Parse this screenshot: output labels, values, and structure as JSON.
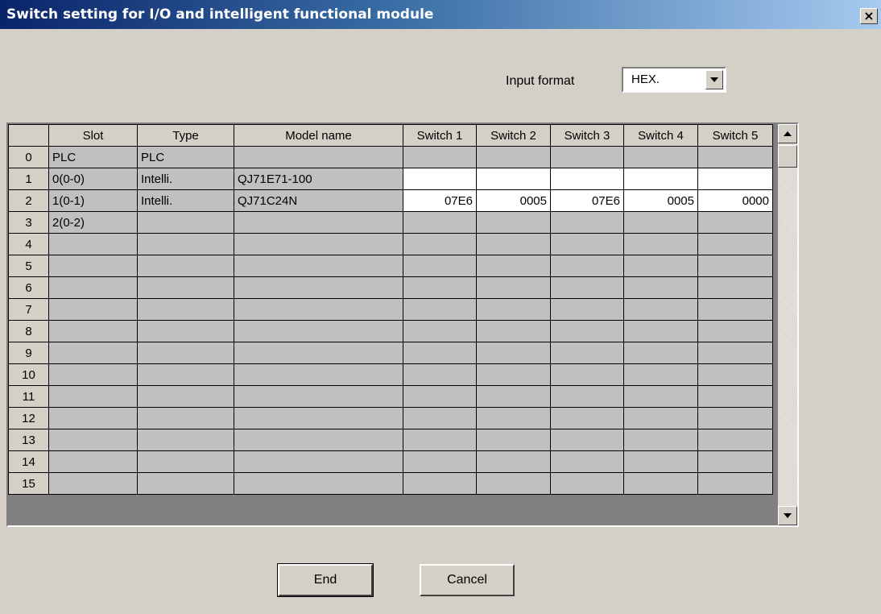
{
  "window": {
    "title": "Switch setting for I/O and intelligent functional module",
    "close_label": "×"
  },
  "input_format": {
    "label": "Input format",
    "value": "HEX."
  },
  "table": {
    "headers": [
      "",
      "Slot",
      "Type",
      "Model name",
      "Switch 1",
      "Switch 2",
      "Switch 3",
      "Switch 4",
      "Switch 5"
    ],
    "rows": [
      [
        "0",
        "PLC",
        "PLC",
        "",
        "",
        "",
        "",
        "",
        ""
      ],
      [
        "1",
        "0(0-0)",
        "Intelli.",
        "QJ71E71-100",
        "",
        "",
        "",
        "",
        ""
      ],
      [
        "2",
        "1(0-1)",
        "Intelli.",
        "QJ71C24N",
        "07E6",
        "0005",
        "07E6",
        "0005",
        "0000"
      ],
      [
        "3",
        "2(0-2)",
        "",
        "",
        "",
        "",
        "",
        "",
        ""
      ],
      [
        "4",
        "",
        "",
        "",
        "",
        "",
        "",
        "",
        ""
      ],
      [
        "5",
        "",
        "",
        "",
        "",
        "",
        "",
        "",
        ""
      ],
      [
        "6",
        "",
        "",
        "",
        "",
        "",
        "",
        "",
        ""
      ],
      [
        "7",
        "",
        "",
        "",
        "",
        "",
        "",
        "",
        ""
      ],
      [
        "8",
        "",
        "",
        "",
        "",
        "",
        "",
        "",
        ""
      ],
      [
        "9",
        "",
        "",
        "",
        "",
        "",
        "",
        "",
        ""
      ],
      [
        "10",
        "",
        "",
        "",
        "",
        "",
        "",
        "",
        ""
      ],
      [
        "11",
        "",
        "",
        "",
        "",
        "",
        "",
        "",
        ""
      ],
      [
        "12",
        "",
        "",
        "",
        "",
        "",
        "",
        "",
        ""
      ],
      [
        "13",
        "",
        "",
        "",
        "",
        "",
        "",
        "",
        ""
      ],
      [
        "14",
        "",
        "",
        "",
        "",
        "",
        "",
        "",
        ""
      ],
      [
        "15",
        "",
        "",
        "",
        "",
        "",
        "",
        "",
        ""
      ]
    ],
    "editable_rows": [
      1,
      2
    ]
  },
  "buttons": {
    "end": "End",
    "cancel": "Cancel"
  }
}
